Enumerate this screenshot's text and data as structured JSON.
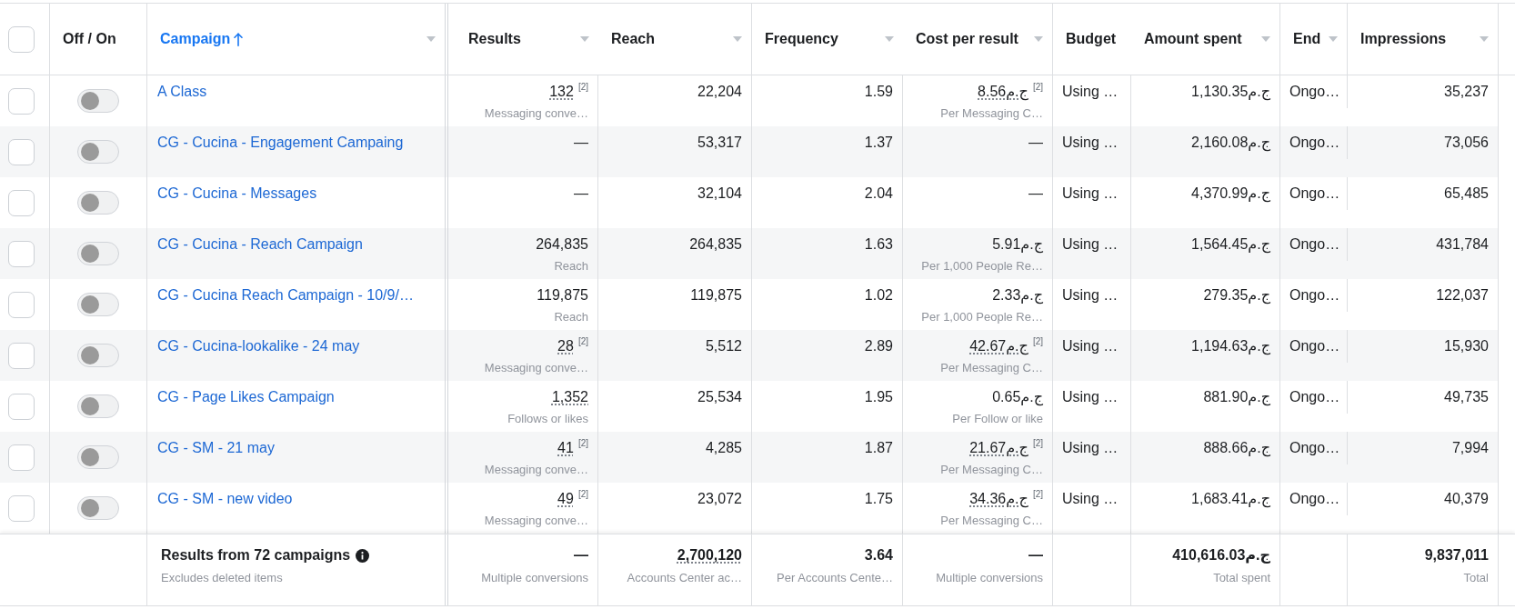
{
  "header": {
    "checkbox": {
      "checked": false
    },
    "columns": [
      {
        "label": "Off / On",
        "sorted": false,
        "menu": false
      },
      {
        "label": "Campaign",
        "sorted": true,
        "menu": true
      },
      {
        "label": "Results",
        "sorted": false,
        "menu": true
      },
      {
        "label": "Reach",
        "sorted": false,
        "menu": true
      },
      {
        "label": "Frequency",
        "sorted": false,
        "menu": true
      },
      {
        "label": "Cost per result",
        "sorted": false,
        "menu": true
      },
      {
        "label": "Budget",
        "sorted": false,
        "menu": false
      },
      {
        "label": "Amount spent",
        "sorted": false,
        "menu": true
      },
      {
        "label": "End",
        "sorted": false,
        "menu": true
      },
      {
        "label": "Impressions",
        "sorted": false,
        "menu": true
      }
    ]
  },
  "rows": [
    {
      "checked": false,
      "on": false,
      "campaign": "A Class",
      "results": {
        "value": "132",
        "note": "[2]",
        "label": "Messaging conve…",
        "has_details": true
      },
      "reach": "22,204",
      "frequency": "1.59",
      "cost_per_result": {
        "value": "8.56ج.م",
        "note": "[2]",
        "label": "Per Messaging C…",
        "has_details": true
      },
      "budget": "Using …",
      "amount_spent": "1,130.35ج.م",
      "ends": "Ongo…",
      "impressions": "35,237"
    },
    {
      "checked": false,
      "on": false,
      "campaign": "CG - Cucina - Engagement Campaing",
      "results": {
        "value": "—",
        "has_details": false
      },
      "reach": "53,317",
      "frequency": "1.37",
      "cost_per_result": {
        "value": "—",
        "has_details": false
      },
      "budget": "Using …",
      "amount_spent": "2,160.08ج.م",
      "ends": "Ongo…",
      "impressions": "73,056"
    },
    {
      "checked": false,
      "on": false,
      "campaign": "CG - Cucina - Messages",
      "results": {
        "value": "—",
        "has_details": false
      },
      "reach": "32,104",
      "frequency": "2.04",
      "cost_per_result": {
        "value": "—",
        "has_details": false
      },
      "budget": "Using …",
      "amount_spent": "4,370.99ج.م",
      "ends": "Ongo…",
      "impressions": "65,485"
    },
    {
      "checked": false,
      "on": false,
      "campaign": "CG - Cucina - Reach Campaign",
      "results": {
        "value": "264,835",
        "label": "Reach",
        "has_details": false
      },
      "reach": "264,835",
      "frequency": "1.63",
      "cost_per_result": {
        "value": "5.91ج.م",
        "label": "Per 1,000 People Re…",
        "has_details": false
      },
      "budget": "Using …",
      "amount_spent": "1,564.45ج.م",
      "ends": "Ongo…",
      "impressions": "431,784"
    },
    {
      "checked": false,
      "on": false,
      "campaign": "CG - Cucina Reach Campaign - 10/9/…",
      "results": {
        "value": "119,875",
        "label": "Reach",
        "has_details": false
      },
      "reach": "119,875",
      "frequency": "1.02",
      "cost_per_result": {
        "value": "2.33ج.م",
        "label": "Per 1,000 People Re…",
        "has_details": false
      },
      "budget": "Using …",
      "amount_spent": "279.35ج.م",
      "ends": "Ongo…",
      "impressions": "122,037"
    },
    {
      "checked": false,
      "on": false,
      "campaign": "CG - Cucina-lookalike - 24 may",
      "results": {
        "value": "28",
        "note": "[2]",
        "label": "Messaging conve…",
        "has_details": true
      },
      "reach": "5,512",
      "frequency": "2.89",
      "cost_per_result": {
        "value": "42.67ج.م",
        "note": "[2]",
        "label": "Per Messaging C…",
        "has_details": true
      },
      "budget": "Using …",
      "amount_spent": "1,194.63ج.م",
      "ends": "Ongo…",
      "impressions": "15,930"
    },
    {
      "checked": false,
      "on": false,
      "campaign": "CG - Page Likes Campaign",
      "results": {
        "value": "1,352",
        "label": "Follows or likes",
        "has_details": true
      },
      "reach": "25,534",
      "frequency": "1.95",
      "cost_per_result": {
        "value": "0.65ج.م",
        "label": "Per Follow or like",
        "has_details": false
      },
      "budget": "Using …",
      "amount_spent": "881.90ج.م",
      "ends": "Ongo…",
      "impressions": "49,735"
    },
    {
      "checked": false,
      "on": false,
      "campaign": "CG - SM - 21 may",
      "results": {
        "value": "41",
        "note": "[2]",
        "label": "Messaging conve…",
        "has_details": true
      },
      "reach": "4,285",
      "frequency": "1.87",
      "cost_per_result": {
        "value": "21.67ج.م",
        "note": "[2]",
        "label": "Per Messaging C…",
        "has_details": true
      },
      "budget": "Using …",
      "amount_spent": "888.66ج.م",
      "ends": "Ongo…",
      "impressions": "7,994"
    },
    {
      "checked": false,
      "on": false,
      "campaign": "CG - SM - new video",
      "results": {
        "value": "49",
        "note": "[2]",
        "label": "Messaging conve…",
        "has_details": true
      },
      "reach": "23,072",
      "frequency": "1.75",
      "cost_per_result": {
        "value": "34.36ج.م",
        "note": "[2]",
        "label": "Per Messaging C…",
        "has_details": true
      },
      "budget": "Using …",
      "amount_spent": "1,683.41ج.م",
      "ends": "Ongo…",
      "impressions": "40,379"
    }
  ],
  "footer": {
    "title": "Results from 72 campaigns",
    "subtitle": "Excludes deleted items",
    "results": {
      "value": "—",
      "label": "Multiple conversions",
      "has_details": false
    },
    "reach": {
      "value": "2,700,120",
      "label": "Accounts Center ac…",
      "has_details": true
    },
    "frequency": {
      "value": "3.64",
      "label": "Per Accounts Cente…",
      "has_details": false
    },
    "cost_per_result": {
      "value": "—",
      "label": "Multiple conversions",
      "has_details": false
    },
    "amount_spent": {
      "value": "410,616.03ج.م",
      "label": "Total spent",
      "has_details": false
    },
    "impressions": {
      "value": "9,837,011",
      "label": "Total",
      "has_details": false
    }
  }
}
